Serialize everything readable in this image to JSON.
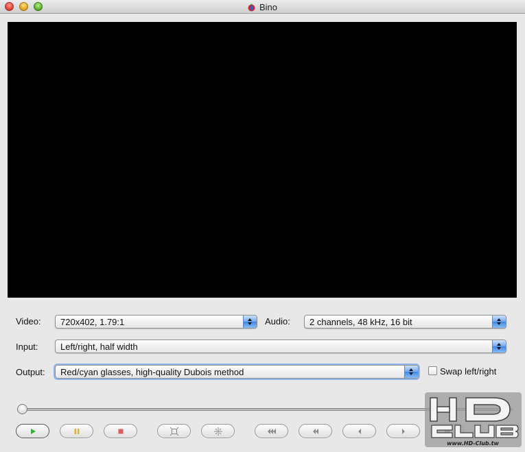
{
  "window": {
    "title": "Bino",
    "icon": "bino-app-icon"
  },
  "controls": {
    "video_label": "Video:",
    "video_value": "720x402, 1.79:1",
    "audio_label": "Audio:",
    "audio_value": "2 channels, 48 kHz, 16 bit",
    "input_label": "Input:",
    "input_value": "Left/right, half width",
    "output_label": "Output:",
    "output_value": "Red/cyan glasses, high-quality Dubois method",
    "swap_label": "Swap left/right",
    "swap_checked": false
  },
  "playback": {
    "seek_position": 0,
    "buttons": [
      {
        "name": "play",
        "icon": "play-icon",
        "color": "#2db52d"
      },
      {
        "name": "pause",
        "icon": "pause-icon",
        "color": "#e0b040"
      },
      {
        "name": "stop",
        "icon": "stop-icon",
        "color": "#e05a5a"
      },
      {
        "name": "fullscreen",
        "icon": "fullscreen-icon"
      },
      {
        "name": "center",
        "icon": "center-icon"
      },
      {
        "name": "seek-back-large",
        "icon": "seek-back-large-icon"
      },
      {
        "name": "seek-back-medium",
        "icon": "seek-back-medium-icon"
      },
      {
        "name": "seek-back-small",
        "icon": "seek-back-small-icon"
      },
      {
        "name": "seek-forward-small",
        "icon": "seek-forward-small-icon"
      },
      {
        "name": "seek-forward-medium",
        "icon": "seek-forward-medium-icon"
      }
    ]
  },
  "watermark": {
    "brand": "HD CLUB",
    "url": "www.HD-Club.tw"
  },
  "colors": {
    "accent_blue": "#3d86e6",
    "video_bg": "#000000",
    "window_bg": "#e8e8e8"
  }
}
